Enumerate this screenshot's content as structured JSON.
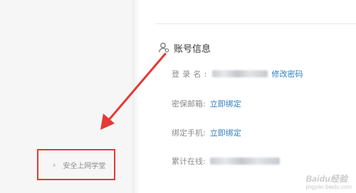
{
  "account": {
    "title": "账号信息",
    "title_icon": "user-icon",
    "login_name_label": "登录名:",
    "change_password_link": "修改密码",
    "email_label": "密保邮箱:",
    "email_action": "立即绑定",
    "phone_label": "绑定手机:",
    "phone_action": "立即绑定",
    "online_label": "累计在线:"
  },
  "sidebar": {
    "item_label": "安全上网学堂",
    "item_icon": "chevron-right-icon"
  },
  "annotation": {
    "box_color": "#e53935",
    "arrow_color": "#e53935"
  },
  "colors": {
    "link": "#2f7fc1",
    "label": "#8a8a8a"
  },
  "watermark": {
    "brand": "Baidu经验",
    "url": "jingyan.baidu.com"
  }
}
